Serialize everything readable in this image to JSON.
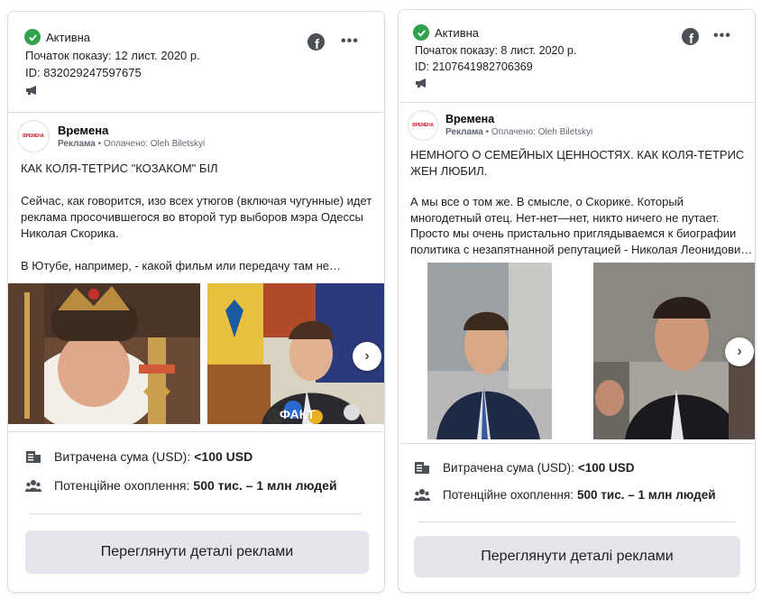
{
  "cards": [
    {
      "status": "Активна",
      "start_label": "Початок показу: 12 лист. 2020 р.",
      "id_label": "ID: 832029247597675",
      "page_name": "Времена",
      "sponsored": "Реклама",
      "paid_by": "Оплачено: Oleh Biletskyi",
      "headline": "КАК КОЛЯ-ТЕТРИС \"КОЗАКОМ\" БІЛ",
      "body": "Сейчас, как говорится, изо всех утюгов (включая чугунные) идет реклама просочившегося во второй тур выборов мэра Одессы Николая Скорика.\n\nВ Ютубе, например, - какой фильм или передачу там не…",
      "spend_label": "Витрачена сума (USD):",
      "spend_value": "<100 USD",
      "reach_label": "Потенційне охоплення:",
      "reach_value": "500 тис. – 1 млн людей",
      "details_button": "Переглянути деталі реклами"
    },
    {
      "status": "Активна",
      "start_label": "Початок показу: 8 лист. 2020 р.",
      "id_label": "ID: 2107641982706369",
      "page_name": "Времена",
      "sponsored": "Реклама",
      "paid_by": "Оплачено: Oleh Biletskyi",
      "headline": "НЕМНОГО О СЕМЕЙНЫХ ЦЕННОСТЯХ. КАК КОЛЯ-ТЕТРИС ЖЕН ЛЮБИЛ.",
      "body": "А мы все о том же. В смысле, о Скорике. Который многодетный отец. Нет-нет—нет, никто ничего не путает. Просто мы очень пристально приглядываемся к биографии политика с незапятнанной репутацией - Николая Леонидови…",
      "spend_label": "Витрачена сума (USD):",
      "spend_value": "<100 USD",
      "reach_label": "Потенційне охоплення:",
      "reach_value": "500 тис. – 1 млн людей",
      "details_button": "Переглянути деталі реклами"
    }
  ],
  "avatar_text": "ВРЕМЕНА",
  "photo_caption": "ФАКТ",
  "icons": {
    "status": "check-circle-icon",
    "platform": "facebook-icon",
    "menu": "more-options-icon",
    "ad_type": "megaphone-icon",
    "spend": "receipt-icon",
    "reach": "people-icon",
    "carousel": "chevron-right-icon"
  },
  "colors": {
    "active_green": "#31a24c",
    "button_bg": "#e4e6eb",
    "border": "#dadde1"
  }
}
